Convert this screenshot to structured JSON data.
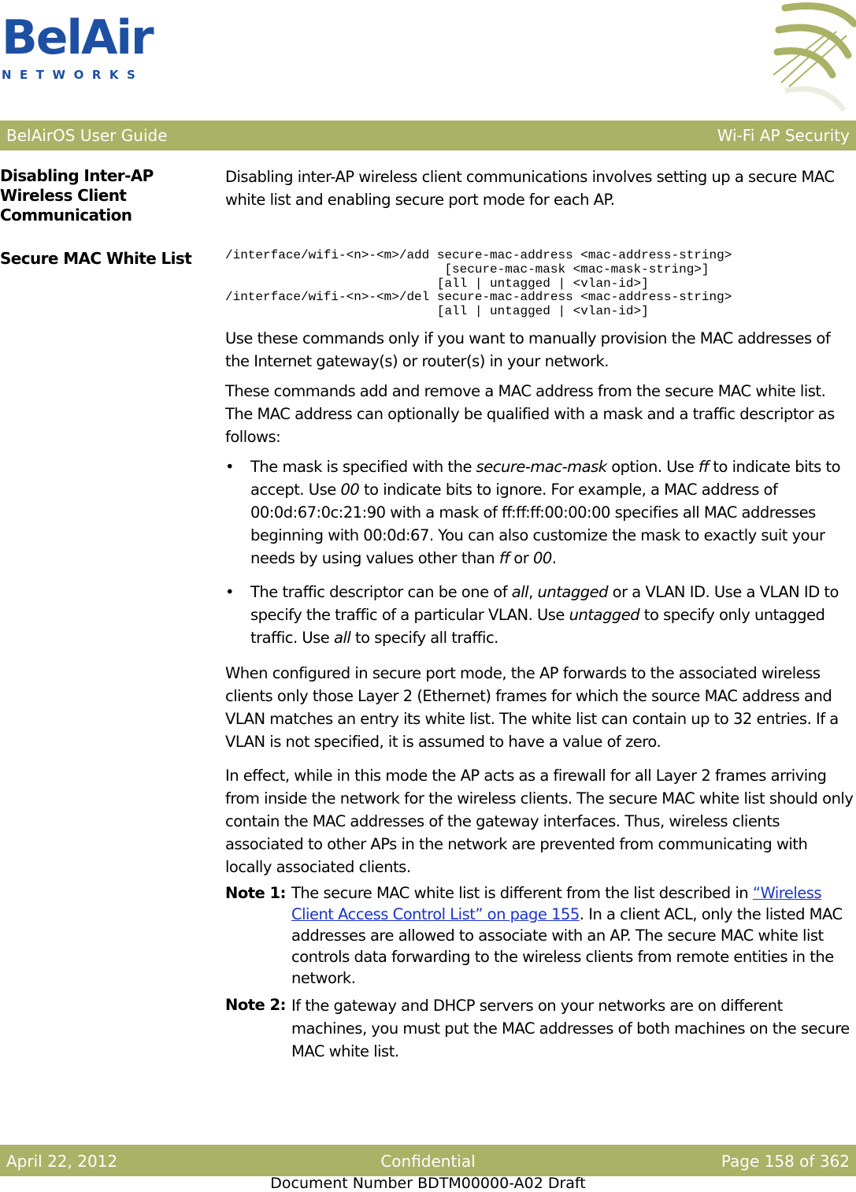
{
  "header": {
    "logo_main": "BelAir",
    "logo_sub": "NETWORKS",
    "guide_title": "BelAirOS User Guide",
    "section_title": "Wi-Fi AP Security",
    "band_color": "#a9b266",
    "logo_color": "#1d50a2"
  },
  "side_headings": {
    "h1": "Disabling Inter-AP Wireless Client Communication",
    "h2": "Secure MAC White List"
  },
  "intro": "Disabling inter-AP wireless client communications involves setting up a secure MAC white list and enabling secure port mode for each AP.",
  "code": "/interface/wifi-<n>-<m>/add secure-mac-address <mac-address-string>\n                             [secure-mac-mask <mac-mask-string>]\n                            [all | untagged | <vlan-id>]\n/interface/wifi-<n>-<m>/del secure-mac-address <mac-address-string>\n                            [all | untagged | <vlan-id>]",
  "paragraphs": {
    "p1": "Use these commands only if you want to manually provision the MAC addresses of the Internet gateway(s) or router(s) in your network.",
    "p2": "These commands add and remove a MAC address from the secure MAC white list. The MAC address can optionally be qualified with a mask and a traffic descriptor as follows:",
    "p3": "When configured in secure port mode, the AP forwards to the associated wireless clients only those Layer 2 (Ethernet) frames for which the source MAC address and VLAN matches an entry its white list. The white list can contain up to 32 entries. If a VLAN is not specified, it is assumed to have a value of zero.",
    "p4": "In effect, while in this mode the AP acts as a firewall for all Layer 2 frames arriving from inside the network for the wireless clients. The secure MAC white list should only contain the MAC addresses of the gateway interfaces. Thus, wireless clients associated to other APs in the network are prevented from communicating with locally associated clients."
  },
  "bullets": {
    "b1": {
      "t1": "The mask is specified with the ",
      "i1": "secure-mac-mask",
      "t2": " option. Use ",
      "i2": "ff",
      "t3": " to indicate bits to accept. Use ",
      "i3": "00",
      "t4": " to indicate bits to ignore. For example, a MAC address of 00:0d:67:0c:21:90 with a mask of ff:ff:ff:00:00:00 specifies all MAC addresses beginning with 00:0d:67. You can also customize the mask to exactly suit your needs by using values other than ",
      "i4": "ff",
      "t5": " or ",
      "i5": "00",
      "t6": "."
    },
    "b2": {
      "t1": "The traffic descriptor can be one of ",
      "i1": "all",
      "t2": ", ",
      "i2": "untagged",
      "t3": " or a VLAN ID. Use a VLAN ID to specify the traffic of a particular VLAN. Use ",
      "i3": "untagged",
      "t4": " to specify only untagged traffic. Use ",
      "i4": "all",
      "t5": " to specify all traffic."
    },
    "bullet_char": "•"
  },
  "notes": {
    "n1": {
      "label": "Note 1:",
      "pre": "The secure MAC white list is different from the list described in ",
      "link": "“Wireless Client Access Control List” on page 155",
      "post": ". In a client ACL, only the listed MAC addresses are allowed to associate with an AP. The secure MAC white list controls data forwarding to the wireless clients from remote entities in the network."
    },
    "n2": {
      "label": "Note 2:",
      "text": "If the gateway and DHCP servers on your networks are on different machines, you must put the MAC addresses of both machines on the secure MAC white list."
    }
  },
  "footer": {
    "date": "April 22, 2012",
    "classification": "Confidential",
    "page": "Page 158 of 362",
    "doc_number": "Document Number BDTM00000-A02 Draft"
  }
}
